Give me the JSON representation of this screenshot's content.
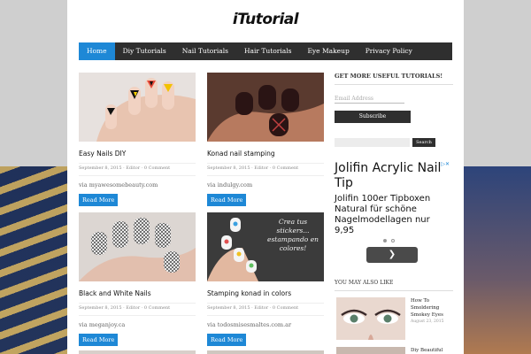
{
  "site": {
    "logo": "iTutorial"
  },
  "nav": {
    "items": [
      {
        "label": "Home"
      },
      {
        "label": "Diy Tutorials"
      },
      {
        "label": "Nail Tutorials"
      },
      {
        "label": "Hair Tutorials"
      },
      {
        "label": "Eye Makeup"
      },
      {
        "label": "Privacy Policy"
      }
    ],
    "active_index": 0
  },
  "posts": [
    {
      "title": "Easy Nails DIY",
      "meta": "September 8, 2015 · Editor · 0 Comment",
      "via": "via myawesomebeauty.com",
      "read_more": "Read More"
    },
    {
      "title": "Konad nail stamping",
      "meta": "September 8, 2015 · Editor · 0 Comment",
      "via": "via indulgy.com",
      "read_more": "Read More"
    },
    {
      "title": "Black and White Nails",
      "meta": "September 8, 2015 · Editor · 0 Comment",
      "via": "via meganjoy.ca",
      "read_more": "Read More"
    },
    {
      "title": "Stamping konad in colors",
      "meta": "September 8, 2015 · Editor · 0 Comment",
      "via": "via todosmisesmaltes.com.ar",
      "read_more": "Read More",
      "thumb_overlay": "Crea tus stickers... estampando en colores!"
    }
  ],
  "sidebar": {
    "newsletter_heading": "GET MORE USEFUL TUTORIALS!",
    "email_placeholder": "Email Address",
    "subscribe_label": "Subscribe",
    "search_label": "Search",
    "ad": {
      "title": "Jolifin Acrylic Nail Tip",
      "body": "Jolifin 100er Tipboxen Natural für schöne Nagelmodellagen nur 9,95",
      "next_icon": "chevron-right-icon"
    },
    "also_heading": "YOU MAY ALSO LIKE",
    "also_items": [
      {
        "title": "How To Smoldering Smokey Eyes",
        "date": "August 23, 2015"
      },
      {
        "title": "Diy Beautiful"
      }
    ]
  },
  "colors": {
    "accent": "#1e88d6",
    "nav_bg": "#2f2f2f",
    "page_bg": "#ffffff"
  }
}
